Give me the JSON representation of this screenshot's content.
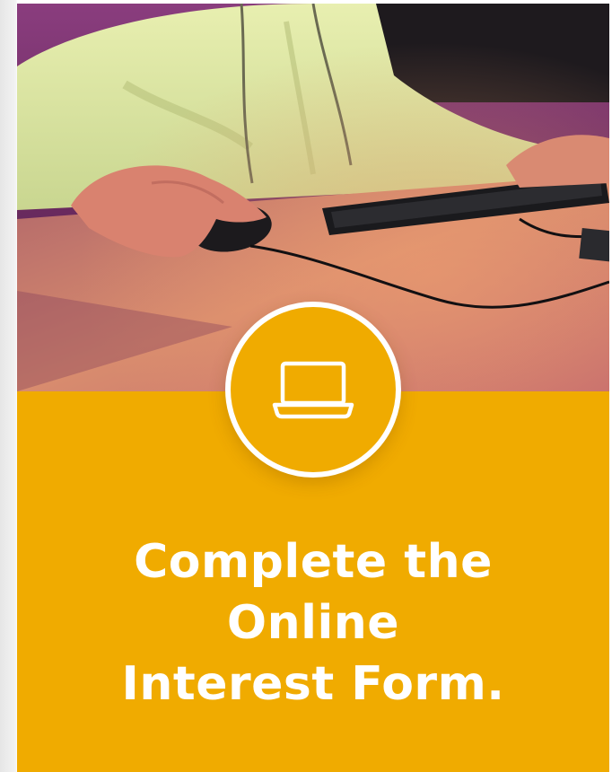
{
  "hero_image": {
    "description": "",
    "icon": "laptop-icon"
  },
  "headline": {
    "line1": "Complete the",
    "line2": "Online",
    "line3": "Interest Form."
  },
  "colors": {
    "accent": "#f0ab00",
    "text": "#ffffff"
  }
}
